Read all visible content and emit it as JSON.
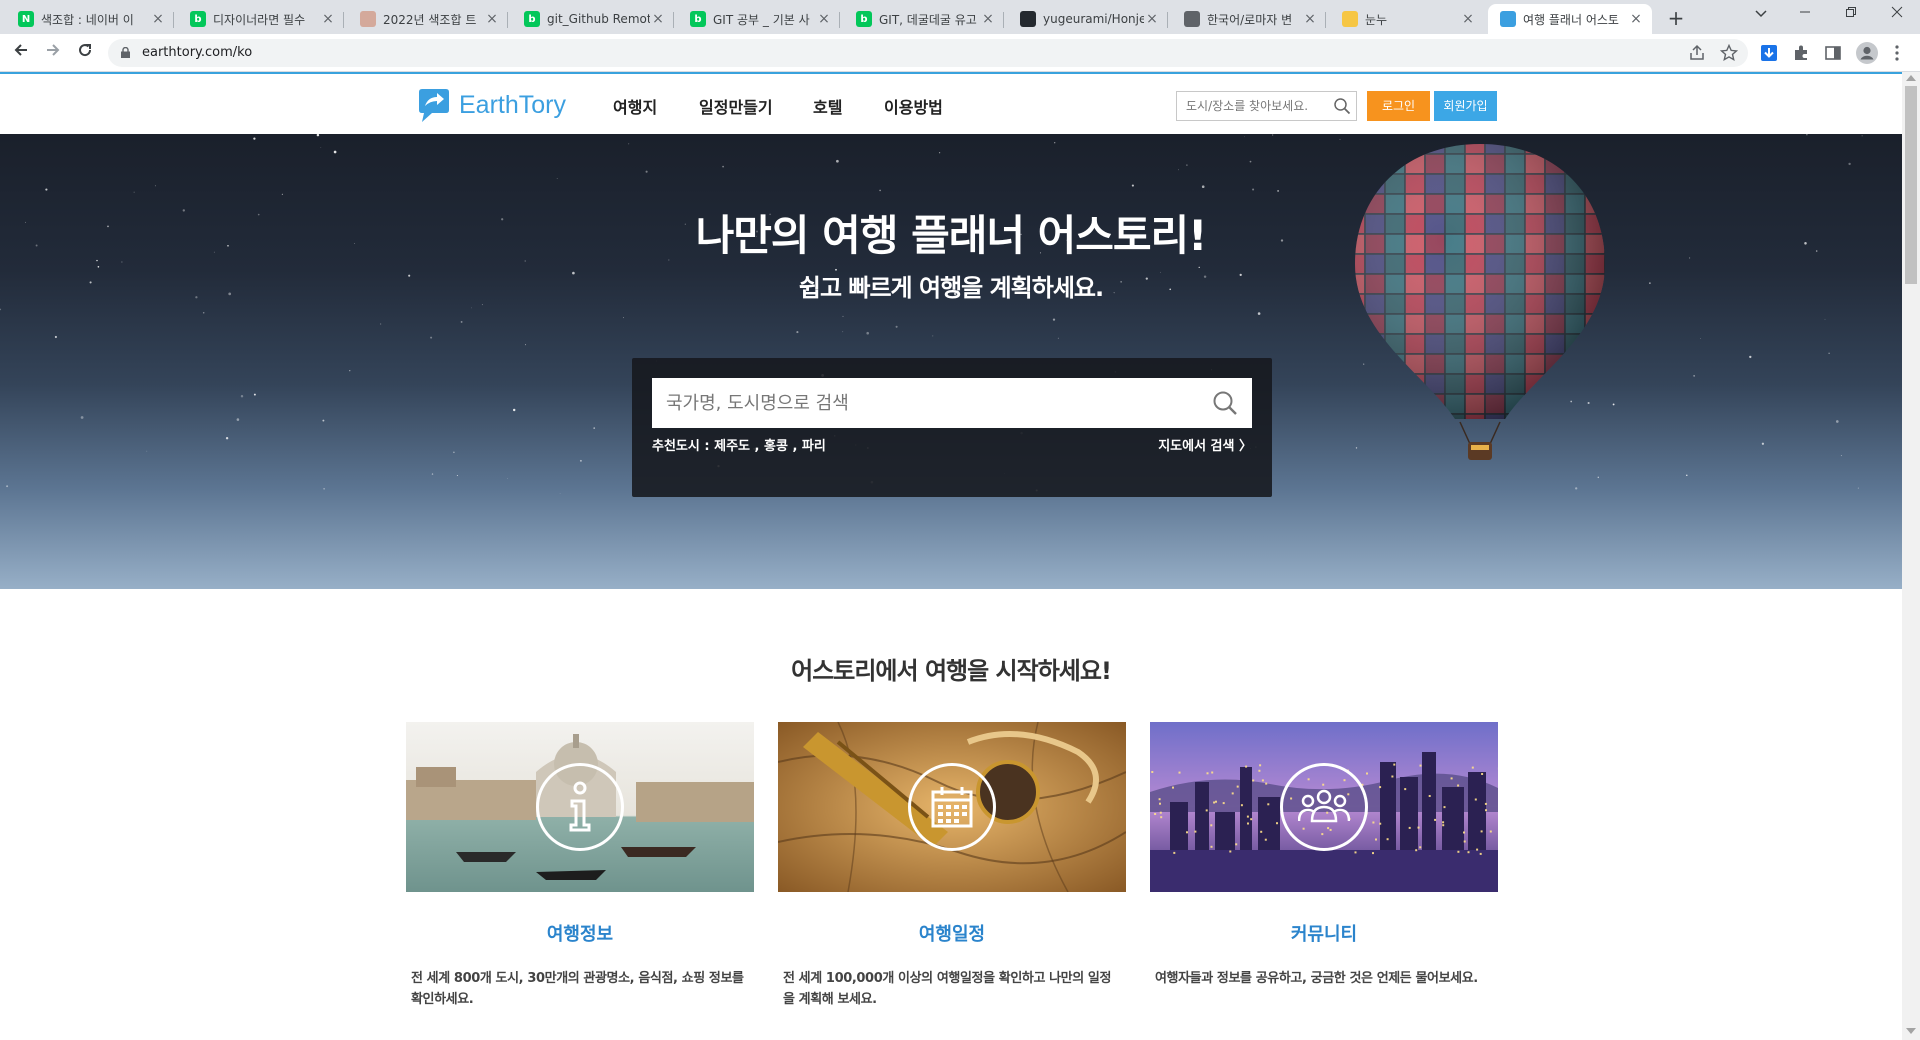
{
  "browser": {
    "tabs": [
      {
        "title": "색조합 : 네이버 이",
        "favicon_color": "#03c75a",
        "favicon_letter": "N",
        "active": false
      },
      {
        "title": "디자이너라면 필수",
        "favicon_color": "#03c75a",
        "favicon_letter": "b",
        "active": false
      },
      {
        "title": "2022년 색조합 트",
        "favicon_color": "#d4a99b",
        "favicon_letter": "",
        "active": false
      },
      {
        "title": "git_Github Remote",
        "favicon_color": "#03c75a",
        "favicon_letter": "b",
        "active": false
      },
      {
        "title": "GIT 공부 _ 기본 사",
        "favicon_color": "#03c75a",
        "favicon_letter": "b",
        "active": false
      },
      {
        "title": "GIT, 데굴데굴 유고",
        "favicon_color": "#03c75a",
        "favicon_letter": "b",
        "active": false
      },
      {
        "title": "yugeurami/Honjec",
        "favicon_color": "#24292f",
        "favicon_letter": "",
        "active": false
      },
      {
        "title": "한국어/로마자 변",
        "favicon_color": "#5f6368",
        "favicon_letter": "",
        "active": false
      },
      {
        "title": "눈누",
        "favicon_color": "#f6c644",
        "favicon_letter": "",
        "active": false
      },
      {
        "title": "여행 플래너 어스토",
        "favicon_color": "#3b9fe0",
        "favicon_letter": "",
        "active": true
      }
    ],
    "url": "earthtory.com/ko"
  },
  "header": {
    "logo_text": "EarthTory",
    "nav": [
      "여행지",
      "일정만들기",
      "호텔",
      "이용방법"
    ],
    "search_placeholder": "도시/장소를 찾아보세요.",
    "login_label": "로그인",
    "join_label": "회원가입"
  },
  "hero": {
    "title": "나만의 여행 플래너 어스토리!",
    "subtitle": "쉽고 빠르게 여행을 계획하세요.",
    "search_placeholder": "국가명, 도시명으로 검색",
    "recommend_label": "추천도시 :",
    "recommend_cities": [
      "제주도",
      "홍콩",
      "파리"
    ],
    "map_search_label": "지도에서 검색 〉"
  },
  "intro": {
    "title": "어스토리에서 여행을 시작하세요!",
    "cards": [
      {
        "title": "여행정보",
        "text": "전 세계 800개 도시, 30만개의 관광명소, 음식점, 쇼핑 정보를 확인하세요.",
        "icon": "info-icon"
      },
      {
        "title": "여행일정",
        "text": "전 세계 100,000개 이상의 여행일정을 확인하고 나만의 일정을 계획해 보세요.",
        "icon": "calendar-icon"
      },
      {
        "title": "커뮤니티",
        "text": "여행자들과 정보를 공유하고, 궁금한 것은 언제든 물어보세요.",
        "icon": "community-icon"
      }
    ]
  },
  "colors": {
    "brand_blue": "#3b9fe0",
    "login_orange": "#f7931e",
    "join_blue": "#3ca7e6",
    "card_title_blue": "#2b84cc"
  }
}
